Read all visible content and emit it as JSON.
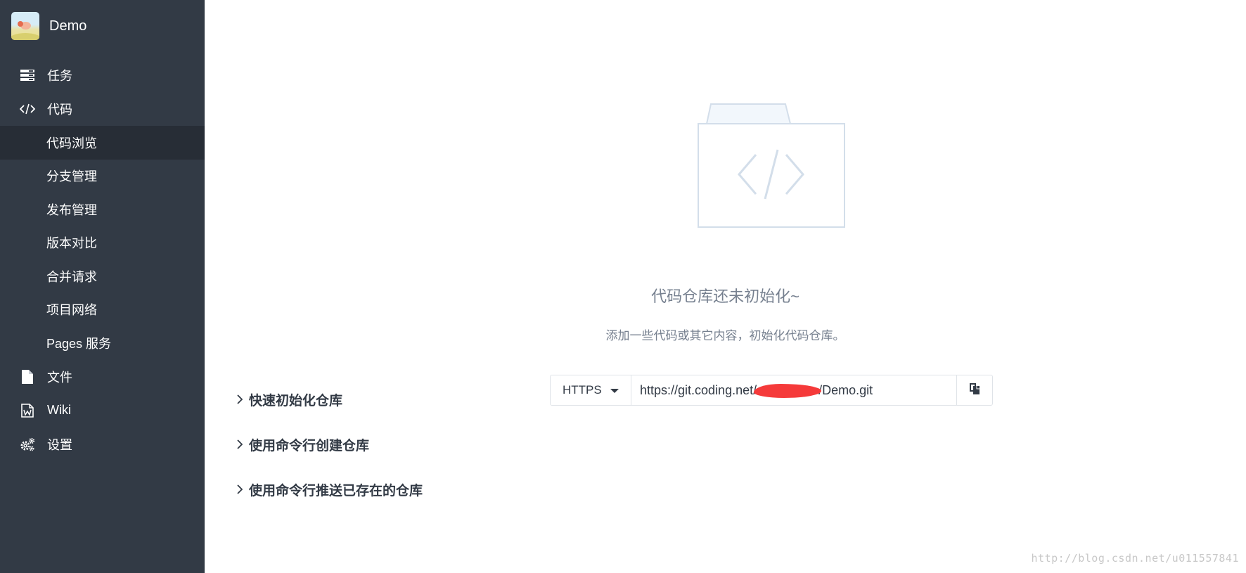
{
  "app": {
    "project_name": "Demo"
  },
  "sidebar": {
    "items": [
      {
        "label": "任务",
        "icon": "task-list-icon"
      },
      {
        "label": "代码",
        "icon": "code-icon"
      },
      {
        "label": "代码浏览",
        "sub": true,
        "active": true
      },
      {
        "label": "分支管理",
        "sub": true
      },
      {
        "label": "发布管理",
        "sub": true
      },
      {
        "label": "版本对比",
        "sub": true
      },
      {
        "label": "合并请求",
        "sub": true
      },
      {
        "label": "项目网络",
        "sub": true
      },
      {
        "label": "Pages 服务",
        "sub": true
      },
      {
        "label": "文件",
        "icon": "file-icon"
      },
      {
        "label": "Wiki",
        "icon": "wiki-icon"
      },
      {
        "label": "设置",
        "icon": "settings-icon"
      }
    ]
  },
  "main": {
    "empty_icon": "code-folder-icon",
    "empty_title": "代码仓库还未初始化~",
    "empty_desc": "添加一些代码或其它内容，初始化代码仓库。",
    "clone": {
      "protocol": "HTTPS",
      "url_prefix": "https://git.coding.net/",
      "url_suffix": "/Demo.git",
      "copy_icon": "copy-icon"
    },
    "sections": [
      {
        "label": "快速初始化仓库"
      },
      {
        "label": "使用命令行创建仓库"
      },
      {
        "label": "使用命令行推送已存在的仓库"
      }
    ]
  },
  "watermark": "http://blog.csdn.net/u011557841",
  "colors": {
    "sidebar_bg": "#323a45",
    "sidebar_active_bg": "#272d36",
    "muted_text": "#76808f",
    "redaction": "#f53a3a"
  }
}
